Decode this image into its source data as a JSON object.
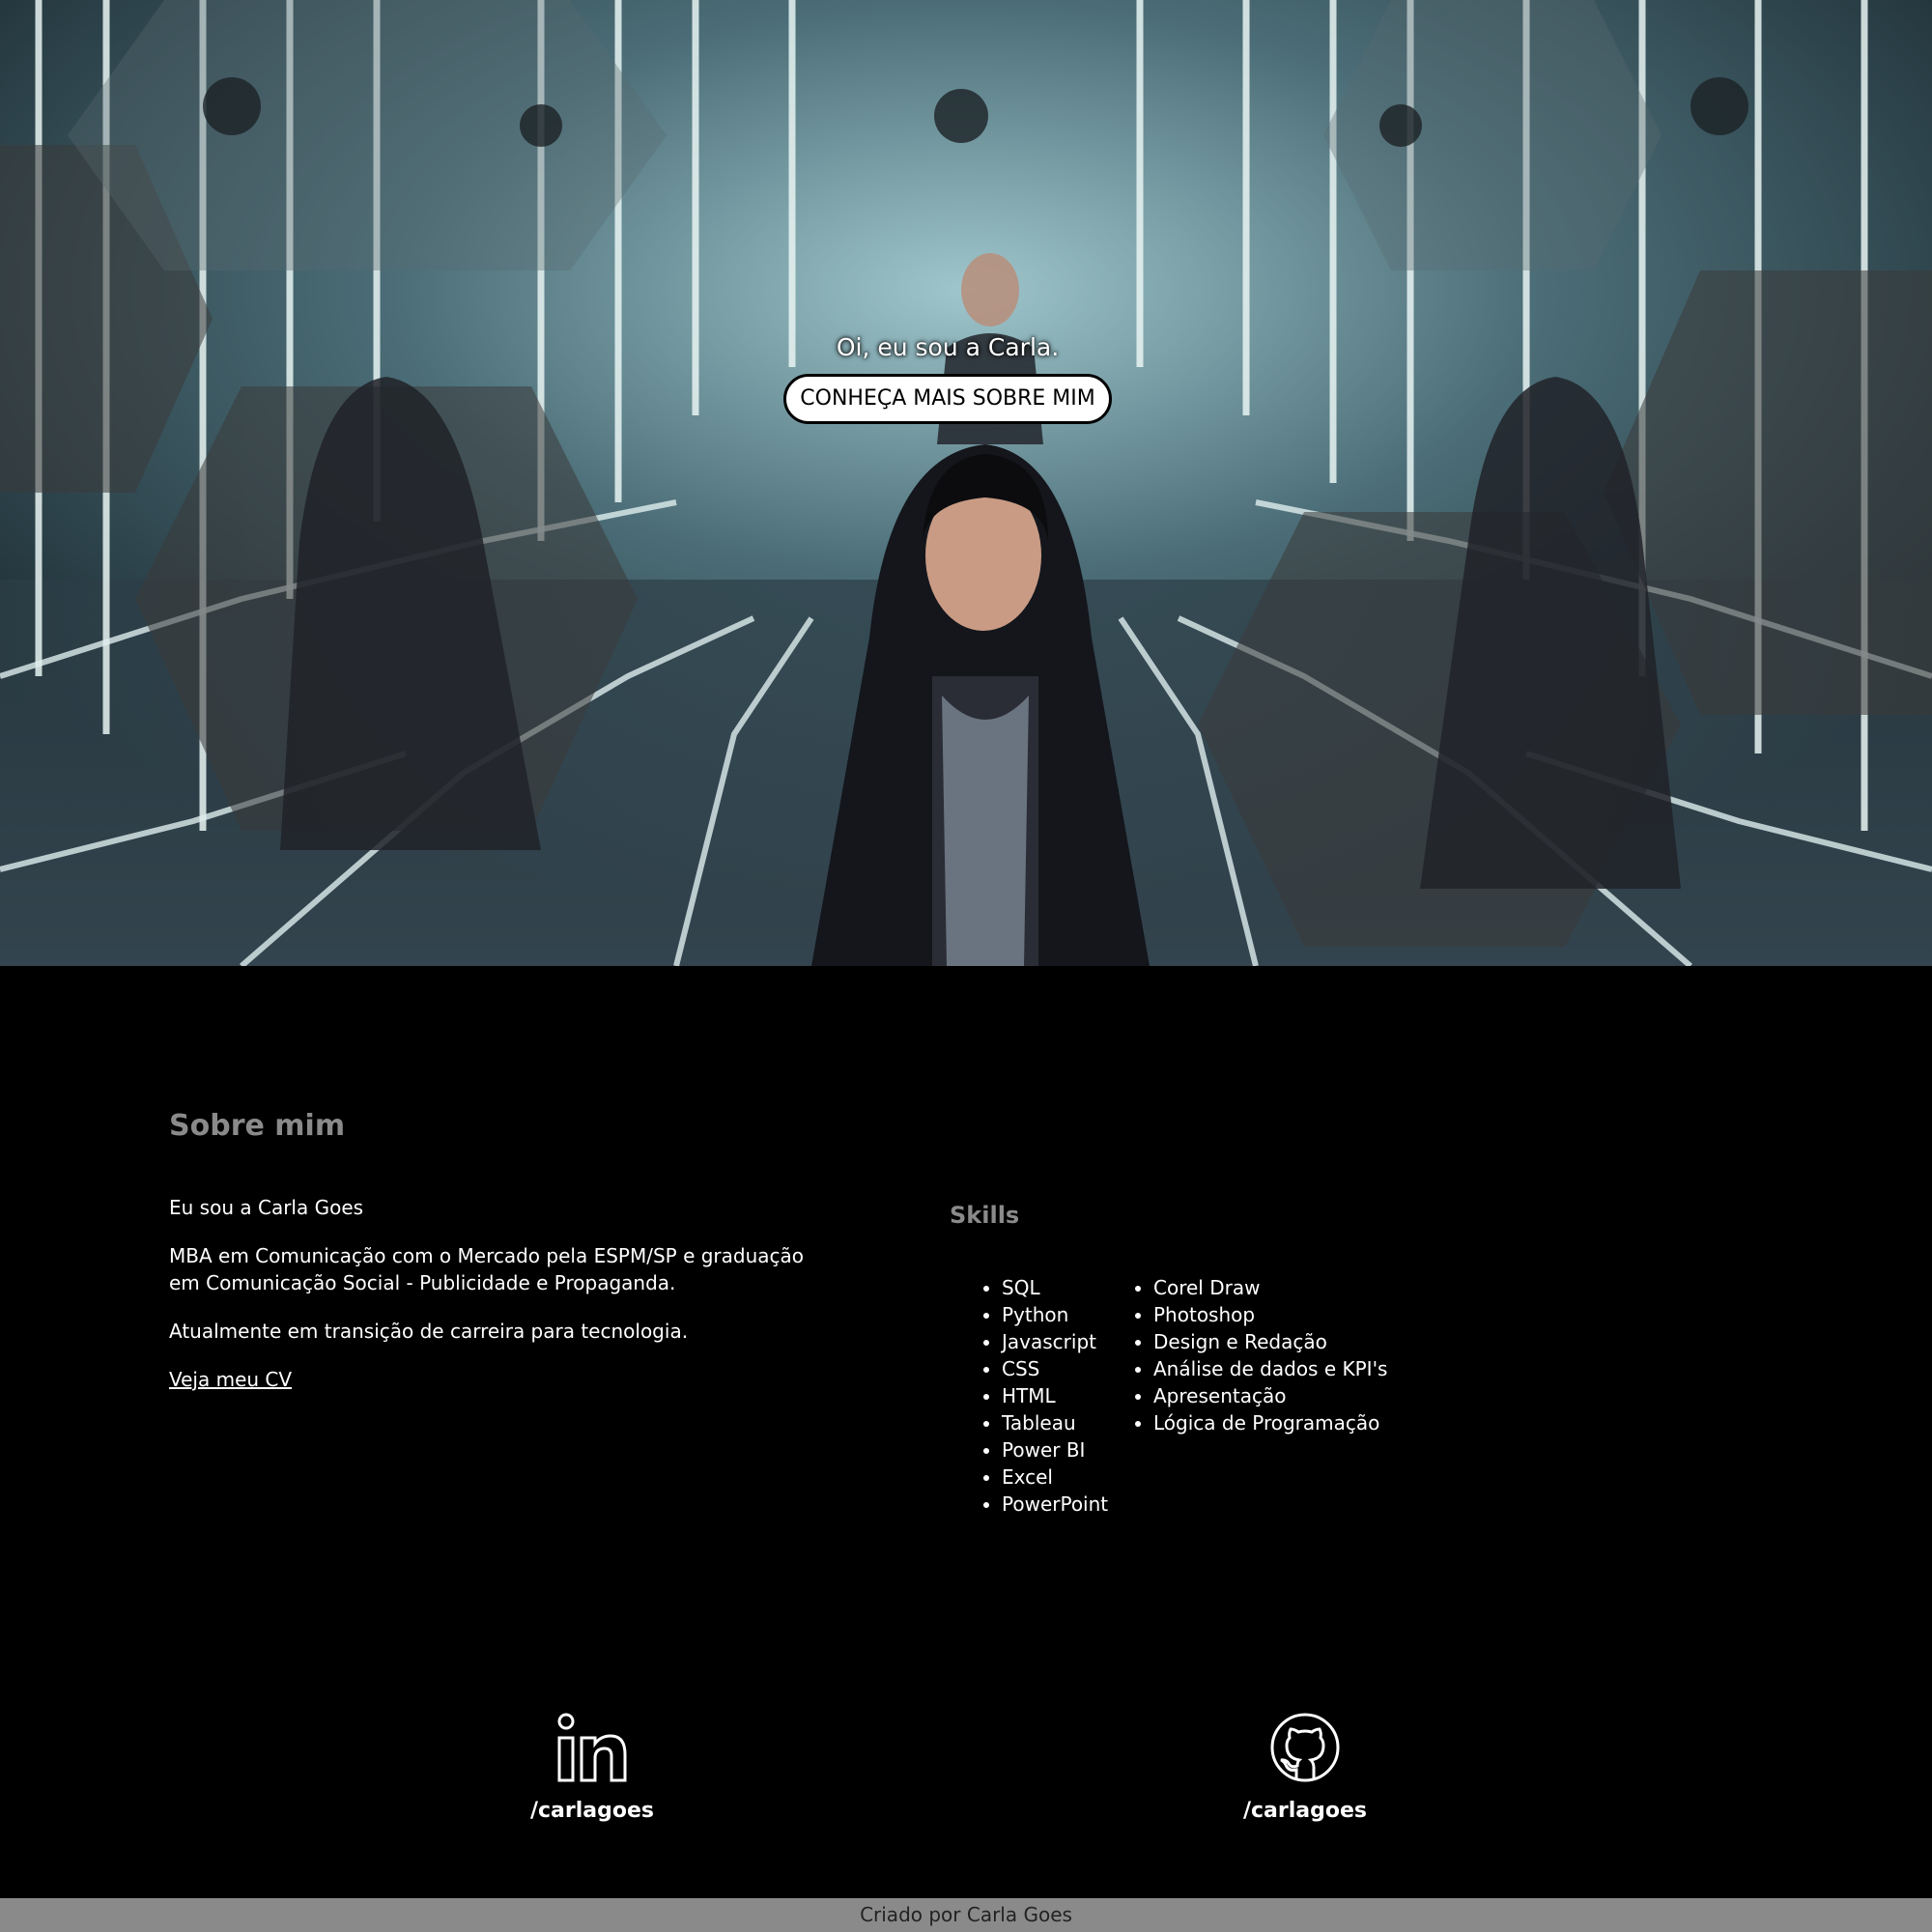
{
  "hero": {
    "greeting": "Oi, eu sou a Carla.",
    "button_label": "CONHEÇA MAIS SOBRE MIM"
  },
  "about": {
    "title": "Sobre mim",
    "intro": "Eu sou a Carla Goes",
    "education": "MBA em Comunicação com o Mercado pela ESPM/SP e graduação em Comunicação Social - Publicidade e Propaganda.",
    "current": "Atualmente em transição de carreira para tecnologia.",
    "cv_link": "Veja meu CV"
  },
  "skills": {
    "title": "Skills",
    "col1": [
      "SQL",
      "Python",
      "Javascript",
      "CSS",
      "HTML",
      "Tableau",
      "Power BI",
      "Excel",
      "PowerPoint"
    ],
    "col2": [
      "Corel Draw",
      "Photoshop",
      "Design e Redação",
      "Análise de dados e KPI's",
      "Apresentação",
      "Lógica de Programação"
    ]
  },
  "social": {
    "linkedin": {
      "icon": "linkedin-icon",
      "handle": "/carlagoes"
    },
    "github": {
      "icon": "github-icon",
      "handle": "/carlagoes"
    }
  },
  "footer": {
    "text": "Criado por Carla Goes"
  },
  "colors": {
    "background": "#000000",
    "heading": "#8a8a8a",
    "footer_bg": "#8a8a8a",
    "text": "#ffffff"
  }
}
